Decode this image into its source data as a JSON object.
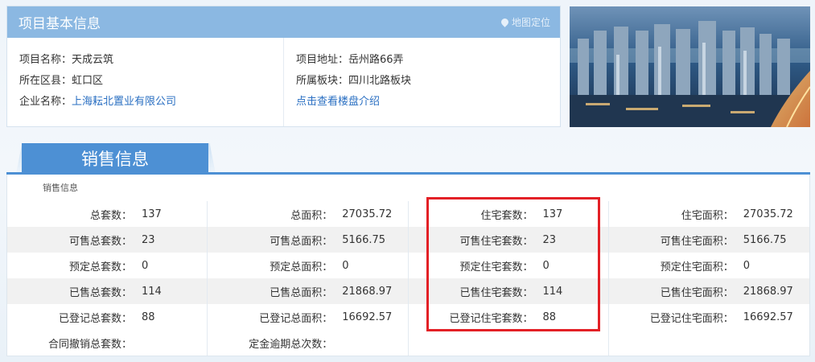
{
  "project_info": {
    "title": "项目基本信息",
    "map_link": "地图定位",
    "left_rows": [
      {
        "label": "项目名称：",
        "value": "天成云筑"
      },
      {
        "label": "所在区县：",
        "value": "虹口区"
      },
      {
        "label": "企业名称：",
        "value": "上海耘北置业有限公司"
      }
    ],
    "right_rows": [
      {
        "label": "项目地址：",
        "value": "岳州路66弄"
      },
      {
        "label": "所属板块：",
        "value": "四川北路板块"
      }
    ],
    "intro_link": "点击查看楼盘介绍"
  },
  "sales": {
    "tab_title": "销售信息",
    "sub_title": "销售信息",
    "col1": [
      {
        "k": "总套数：",
        "v": "137"
      },
      {
        "k": "可售总套数：",
        "v": "23"
      },
      {
        "k": "预定总套数：",
        "v": "0"
      },
      {
        "k": "已售总套数：",
        "v": "114"
      },
      {
        "k": "已登记总套数：",
        "v": "88"
      },
      {
        "k": "合同撤销总套数：",
        "v": ""
      }
    ],
    "col2": [
      {
        "k": "总面积：",
        "v": "27035.72"
      },
      {
        "k": "可售总面积：",
        "v": "5166.75"
      },
      {
        "k": "预定总面积：",
        "v": "0"
      },
      {
        "k": "已售总面积：",
        "v": "21868.97"
      },
      {
        "k": "已登记总面积：",
        "v": "16692.57"
      },
      {
        "k": "定金逾期总次数：",
        "v": ""
      }
    ],
    "col3": [
      {
        "k": "住宅套数：",
        "v": "137"
      },
      {
        "k": "可售住宅套数：",
        "v": "23"
      },
      {
        "k": "预定住宅套数：",
        "v": "0"
      },
      {
        "k": "已售住宅套数：",
        "v": "114"
      },
      {
        "k": "已登记住宅套数：",
        "v": "88"
      },
      {
        "k": "",
        "v": ""
      }
    ],
    "col4": [
      {
        "k": "住宅面积：",
        "v": "27035.72"
      },
      {
        "k": "可售住宅面积：",
        "v": "5166.75"
      },
      {
        "k": "预定住宅面积：",
        "v": "0"
      },
      {
        "k": "已售住宅面积：",
        "v": "21868.97"
      },
      {
        "k": "已登记住宅面积：",
        "v": "16692.57"
      },
      {
        "k": "",
        "v": ""
      }
    ]
  },
  "colors": {
    "header_blue": "#8bb8e2",
    "tab_blue": "#4d90d4",
    "link_blue": "#2a6fc2",
    "highlight_red": "#e32026"
  }
}
